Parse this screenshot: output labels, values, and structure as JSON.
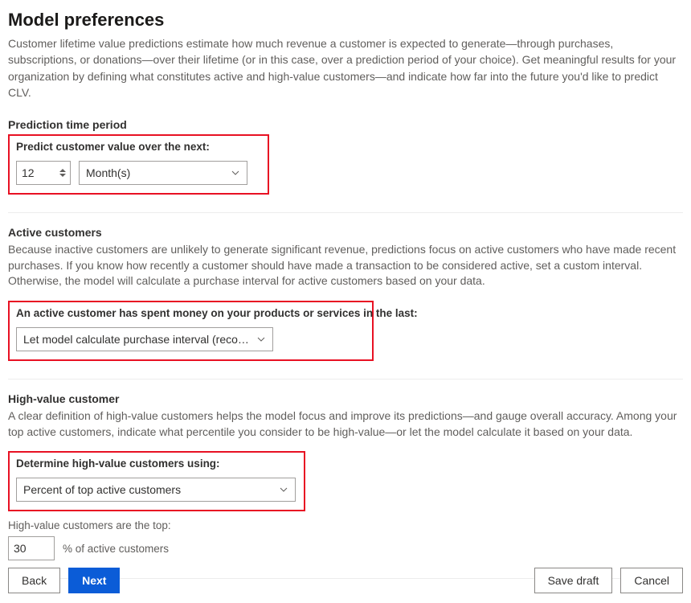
{
  "title": "Model preferences",
  "intro": "Customer lifetime value predictions estimate how much revenue a customer is expected to generate—through purchases, subscriptions, or donations—over their lifetime (or in this case, over a prediction period of your choice). Get meaningful results for your organization by defining what constitutes active and high-value customers—and indicate how far into the future you'd like to predict CLV.",
  "prediction": {
    "heading": "Prediction time period",
    "label": "Predict customer value over the next:",
    "value": "12",
    "unit": "Month(s)"
  },
  "active": {
    "heading": "Active customers",
    "desc": "Because inactive customers are unlikely to generate significant revenue, predictions focus on active customers who have made recent purchases. If you know how recently a customer should have made a transaction to be considered active, set a custom interval. Otherwise, the model will calculate a purchase interval for active customers based on your data.",
    "label": "An active customer has spent money on your products or services in the last:",
    "selected": "Let model calculate purchase interval (recommend…"
  },
  "highvalue": {
    "heading": "High-value customer",
    "desc": "A clear definition of high-value customers helps the model focus and improve its predictions—and gauge overall accuracy. Among your top active customers, indicate what percentile you consider to be high-value—or let the model calculate it based on your data.",
    "label": "Determine high-value customers using:",
    "selected": "Percent of top active customers",
    "sublabel": "High-value customers are the top:",
    "percent": "30",
    "suffix": "%  of active customers"
  },
  "footer": {
    "back": "Back",
    "next": "Next",
    "save_draft": "Save draft",
    "cancel": "Cancel"
  }
}
